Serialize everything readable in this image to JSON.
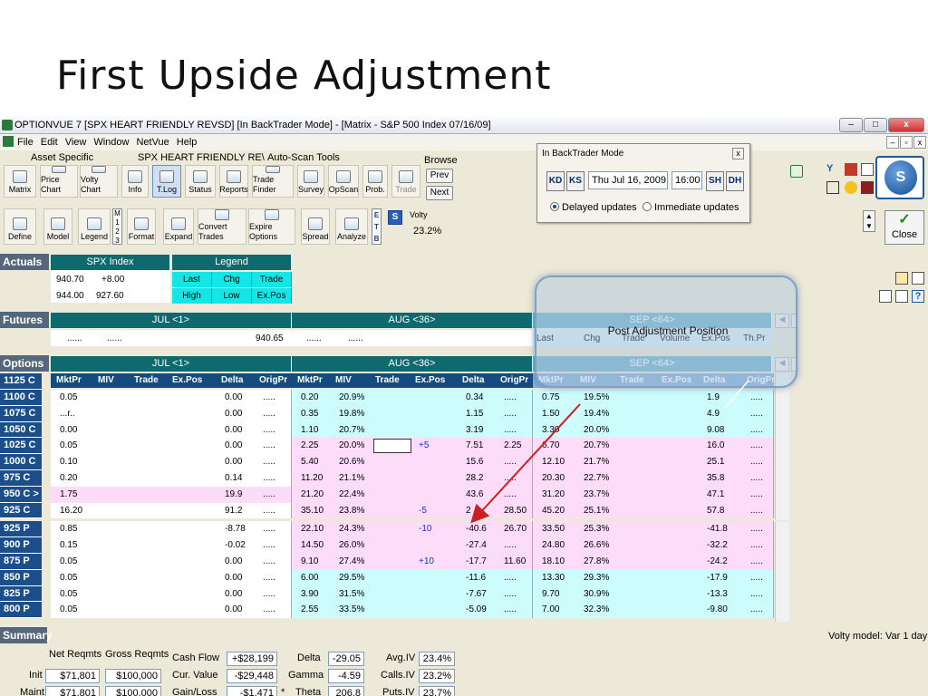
{
  "slide": {
    "title": "First  Upside Adjustment"
  },
  "window": {
    "title": "OPTIONVUE 7   [SPX HEART FRIENDLY REVSD]   [In BackTrader Mode] - [Matrix - S&P 500 Index  07/16/09]",
    "minimize": "–",
    "maximize": "□",
    "close": "x"
  },
  "menu": {
    "items": [
      "File",
      "Edit",
      "View",
      "Window",
      "NetVue",
      "Help"
    ],
    "mdi": [
      "–",
      "▫",
      "x"
    ]
  },
  "toolbar": {
    "group1_label": "Asset Specific",
    "group2_label": "SPX HEART FRIENDLY RE\\",
    "group3_label": "Auto-Scan Tools",
    "browse_label": "Browse",
    "prev": "Prev",
    "next": "Next",
    "row1": [
      "Matrix",
      "Price Chart",
      "Volty Chart",
      "Info",
      "T.Log",
      "Status",
      "Reports",
      "Trade Finder",
      "Survey",
      "OpScan",
      "Prob.",
      "Trade"
    ],
    "row2": [
      "Define",
      "Model",
      "Legend",
      "Format",
      "Expand",
      "Convert Trades",
      "Expire Options",
      "Spread",
      "Analyze"
    ],
    "stack_123": [
      "M",
      "1",
      "2",
      "3"
    ],
    "stack_etb": [
      "E",
      "T",
      "B"
    ],
    "s_label": "S",
    "volty_label": "Volty",
    "volty_value": "23.2%",
    "close_label": "Close",
    "close_icon": "✓"
  },
  "backtrader": {
    "title": "In BackTrader Mode",
    "close": "x",
    "date": "Thu Jul 16, 2009",
    "time": "16:00",
    "nav_first": "KD",
    "nav_prev": "KS",
    "nav_next": "SH",
    "nav_last": "DH",
    "radio_delayed": "Delayed updates",
    "radio_immediate": "Immediate updates"
  },
  "actuals": {
    "section": "Actuals",
    "header": "SPX Index",
    "last": "940.70",
    "chg": "+8.00",
    "high": "944.00",
    "low": "927.60",
    "legend_header": "Legend",
    "legend": [
      "Last",
      "Chg",
      "Trade",
      "High",
      "Low",
      "Ex.Pos"
    ]
  },
  "futures": {
    "section": "Futures",
    "months": [
      "JUL <1>",
      "AUG <36>",
      "SEP <64>"
    ],
    "jul_dots": [
      "......",
      "......"
    ],
    "jul_value": "940.65",
    "aug_dots": [
      "......",
      "......"
    ],
    "sep_cols": [
      "Last",
      "Chg",
      "Trade",
      "Volume",
      "Ex.Pos",
      "Th.Pr"
    ]
  },
  "options": {
    "section": "Options",
    "months": [
      "JUL <1>",
      "AUG <36>",
      "SEP <64>"
    ],
    "jul_cols": [
      "MktPr",
      "MIV",
      "Trade",
      "Ex.Pos",
      "Delta",
      "OrigPr"
    ],
    "aug_cols": [
      "MktPr",
      "MIV",
      "Trade",
      "Ex.Pos",
      "Delta",
      "OrigPr"
    ],
    "sep_cols": [
      "MktPr",
      "MIV",
      "Trade",
      "Ex.Pos",
      "Delta",
      "OrigPr"
    ],
    "rows": [
      {
        "strike": "1125 C",
        "jul": [
          "",
          "",
          "",
          "",
          "",
          ""
        ],
        "aug": [
          "",
          "",
          "",
          "",
          "",
          ""
        ],
        "sep": [
          "",
          "",
          "",
          "",
          "",
          ""
        ]
      },
      {
        "strike": "1100 C",
        "jul": [
          "0.05",
          "",
          "",
          "",
          "0.00",
          "....."
        ],
        "aug": [
          "0.20",
          "20.9%",
          "",
          "",
          "0.34",
          "....."
        ],
        "sep": [
          "0.75",
          "19.5%",
          "",
          "",
          "1.9",
          "....."
        ]
      },
      {
        "strike": "1075 C",
        "jul": [
          "...r..",
          "",
          "",
          "",
          "0.00",
          "....."
        ],
        "aug": [
          "0.35",
          "19.8%",
          "",
          "",
          "1.15",
          "....."
        ],
        "sep": [
          "1.50",
          "19.4%",
          "",
          "",
          "4.9",
          "....."
        ]
      },
      {
        "strike": "1050 C",
        "jul": [
          "0.00",
          "",
          "",
          "",
          "0.00",
          "....."
        ],
        "aug": [
          "1.10",
          "20.7%",
          "",
          "",
          "3.19",
          "....."
        ],
        "sep": [
          "3.30",
          "20.0%",
          "",
          "",
          "9.08",
          "....."
        ]
      },
      {
        "strike": "1025 C",
        "jul": [
          "0.05",
          "",
          "",
          "",
          "0.00",
          "....."
        ],
        "aug": [
          "2.25",
          "20.0%",
          "",
          "+5",
          "7.51",
          "2.25"
        ],
        "sep": [
          "6.70",
          "20.7%",
          "",
          "",
          "16.0",
          "....."
        ]
      },
      {
        "strike": "1000 C",
        "jul": [
          "0.10",
          "",
          "",
          "",
          "0.00",
          "....."
        ],
        "aug": [
          "5.40",
          "20.6%",
          "",
          "",
          "15.6",
          "....."
        ],
        "sep": [
          "12.10",
          "21.7%",
          "",
          "",
          "25.1",
          "....."
        ]
      },
      {
        "strike": "975 C",
        "jul": [
          "0.20",
          "",
          "",
          "",
          "0.14",
          "....."
        ],
        "aug": [
          "11.20",
          "21.1%",
          "",
          "",
          "28.2",
          "....."
        ],
        "sep": [
          "20.30",
          "22.7%",
          "",
          "",
          "35.8",
          "....."
        ]
      },
      {
        "strike": "950 C >",
        "jul": [
          "1.75",
          "",
          "",
          "",
          "19.9",
          "....."
        ],
        "aug": [
          "21.20",
          "22.4%",
          "",
          "",
          "43.6",
          "....."
        ],
        "sep": [
          "31.20",
          "23.7%",
          "",
          "",
          "47.1",
          "....."
        ]
      },
      {
        "strike": "925 C",
        "jul": [
          "16.20",
          "",
          "",
          "",
          "91.2",
          "....."
        ],
        "aug": [
          "35.10",
          "23.8%",
          "",
          "-5",
          "2",
          "28.50"
        ],
        "sep": [
          "45.20",
          "25.1%",
          "",
          "",
          "57.8",
          "....."
        ]
      },
      {
        "strike": "925 P",
        "jul": [
          "0.85",
          "",
          "",
          "",
          "-8.78",
          "....."
        ],
        "aug": [
          "22.10",
          "24.3%",
          "",
          "-10",
          "-40.6",
          "26.70"
        ],
        "sep": [
          "33.50",
          "25.3%",
          "",
          "",
          "-41.8",
          "....."
        ]
      },
      {
        "strike": "900 P",
        "jul": [
          "0.15",
          "",
          "",
          "",
          "-0.02",
          "....."
        ],
        "aug": [
          "14.50",
          "26.0%",
          "",
          "",
          "-27.4",
          "....."
        ],
        "sep": [
          "24.80",
          "26.6%",
          "",
          "",
          "-32.2",
          "....."
        ]
      },
      {
        "strike": "875 P",
        "jul": [
          "0.05",
          "",
          "",
          "",
          "0.00",
          "....."
        ],
        "aug": [
          "9.10",
          "27.4%",
          "",
          "+10",
          "-17.7",
          "11.60"
        ],
        "sep": [
          "18.10",
          "27.8%",
          "",
          "",
          "-24.2",
          "....."
        ]
      },
      {
        "strike": "850 P",
        "jul": [
          "0.05",
          "",
          "",
          "",
          "0.00",
          "....."
        ],
        "aug": [
          "6.00",
          "29.5%",
          "",
          "",
          "-11.6",
          "....."
        ],
        "sep": [
          "13.30",
          "29.3%",
          "",
          "",
          "-17.9",
          "....."
        ]
      },
      {
        "strike": "825 P",
        "jul": [
          "0.05",
          "",
          "",
          "",
          "0.00",
          "....."
        ],
        "aug": [
          "3.90",
          "31.5%",
          "",
          "",
          "-7.67",
          "....."
        ],
        "sep": [
          "9.70",
          "30.9%",
          "",
          "",
          "-13.3",
          "....."
        ]
      },
      {
        "strike": "800 P",
        "jul": [
          "0.05",
          "",
          "",
          "",
          "0.00",
          "....."
        ],
        "aug": [
          "2.55",
          "33.5%",
          "",
          "",
          "-5.09",
          "....."
        ],
        "sep": [
          "7.00",
          "32.3%",
          "",
          "",
          "-9.80",
          "....."
        ]
      }
    ]
  },
  "callout": {
    "text": "Post Adjustment Position"
  },
  "summary": {
    "section": "Summary",
    "model": "Volty model: Var 1 day",
    "col_net": "Net Reqmts",
    "col_gross": "Gross Reqmts",
    "rows": [
      {
        "label": "Init",
        "net": "$71,801",
        "gross": "$100,000"
      },
      {
        "label": "Maint",
        "net": "$71,801",
        "gross": "$100,000"
      }
    ],
    "cash_flow_label": "Cash Flow",
    "cash_flow": "+$28,199",
    "cur_value_label": "Cur. Value",
    "cur_value": "-$29,448",
    "gain_loss_label": "Gain/Loss",
    "gain_loss": "-$1,471",
    "gain_loss_marker": "*",
    "delta_label": "Delta",
    "delta": "-29.05",
    "gamma_label": "Gamma",
    "gamma": "-4.59",
    "theta_label": "Theta",
    "theta": "206.8",
    "avg_iv_label": "Avg.IV",
    "avg_iv": "23.4%",
    "calls_iv_label": "Calls.IV",
    "calls_iv": "23.2%",
    "puts_iv_label": "Puts.IV",
    "puts_iv": "23.7%"
  },
  "colors": {
    "teal_header": "#0f6a70",
    "strike_blue": "#1b4e8a",
    "row_cyan": "#ccfcfc",
    "row_pink": "#fddcfa",
    "legend_cyan": "#15e5e5",
    "arrow_red": "#cc1f1f",
    "trade_blue": "#1a33cc"
  }
}
